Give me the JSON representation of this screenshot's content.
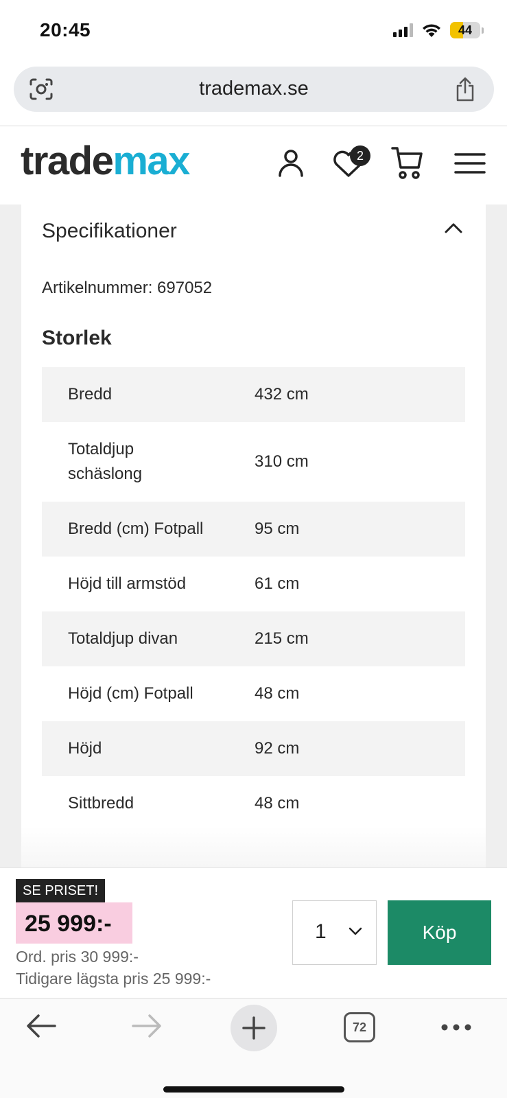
{
  "status_bar": {
    "time": "20:45",
    "battery": "44",
    "icons": [
      "signal-icon",
      "wifi-icon",
      "battery-icon"
    ]
  },
  "browser": {
    "url": "trademax.se",
    "icons": [
      "lens-icon",
      "share-icon"
    ],
    "tabs_count": "72",
    "toolbar_icons": [
      "back-arrow-icon",
      "forward-arrow-icon",
      "plus-icon",
      "tabs-icon",
      "more-icon"
    ]
  },
  "header": {
    "logo_part1": "trade",
    "logo_part2": "max",
    "wishlist_count": "2",
    "icons": [
      "user-icon",
      "heart-icon",
      "cart-icon",
      "menu-icon"
    ],
    "brand_color": "#1aaed3"
  },
  "specs": {
    "title": "Specifikationer",
    "article_number": "Artikelnummer: 697052",
    "size_heading": "Storlek",
    "rows": [
      {
        "label": "Bredd",
        "value": "432 cm"
      },
      {
        "label": "Totaldjup schäslong",
        "value": "310 cm"
      },
      {
        "label": "Bredd (cm) Fotpall",
        "value": "95 cm"
      },
      {
        "label": "Höjd till armstöd",
        "value": "61 cm"
      },
      {
        "label": "Totaldjup divan",
        "value": "215 cm"
      },
      {
        "label": "Höjd (cm) Fotpall",
        "value": "48 cm"
      },
      {
        "label": "Höjd",
        "value": "92 cm"
      },
      {
        "label": "Sittbredd",
        "value": "48 cm"
      }
    ]
  },
  "buy_bar": {
    "promo_tag": "SE PRISET!",
    "price": "25 999:-",
    "ordinary_price": "Ord. pris 30 999:-",
    "lowest_price": "Tidigare lägsta pris 25 999:-",
    "quantity": "1",
    "buy_label": "Köp",
    "buy_color": "#1c8a66",
    "price_highlight_color": "#f9cde0"
  }
}
